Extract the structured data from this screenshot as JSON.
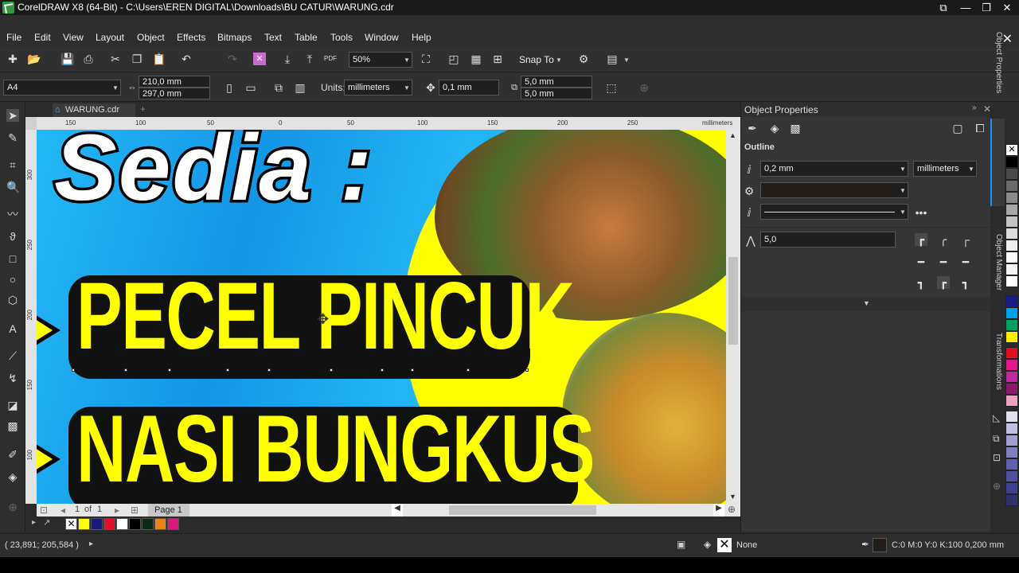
{
  "window": {
    "title": "CorelDRAW X8 (64-Bit) - C:\\Users\\EREN DIGITAL\\Downloads\\BU CATUR\\WARUNG.cdr"
  },
  "menu": [
    "File",
    "Edit",
    "View",
    "Layout",
    "Object",
    "Effects",
    "Bitmaps",
    "Text",
    "Table",
    "Tools",
    "Window",
    "Help"
  ],
  "toolbar": {
    "zoom": "50%",
    "snap": "Snap To"
  },
  "propbar": {
    "page_size": "A4",
    "width": "210,0 mm",
    "height": "297,0 mm",
    "units_label": "Units:",
    "units": "millimeters",
    "nudge": "0,1 mm",
    "dup_x": "5,0 mm",
    "dup_y": "5,0 mm"
  },
  "doc": {
    "tab": "WARUNG.cdr",
    "ruler_unit": "millimeters",
    "h_ticks": [
      "150",
      "100",
      "50",
      "0",
      "50",
      "100",
      "150",
      "200",
      "250"
    ],
    "v_ticks": [
      "300",
      "250",
      "200",
      "150",
      "100"
    ]
  },
  "artwork": {
    "line1": "Sedia :",
    "line2": "PECEL PINCUK",
    "line3": "NASI BUNGKUS"
  },
  "pages": {
    "current": "1",
    "of": "of",
    "total": "1",
    "page_tab": "Page 1"
  },
  "panel": {
    "title": "Object Properties",
    "section": "Outline",
    "width": "0,2 mm",
    "width_units": "millimeters",
    "miter": "5,0"
  },
  "vtabs": [
    "Object Properties",
    "Object Manager",
    "Transformations"
  ],
  "status": {
    "coords": "( 23,891; 205,584 )",
    "fill": "None",
    "outline": "C:0 M:0 Y:0 K:100  0,200 mm"
  },
  "colors": {
    "accent": "#1e90ff",
    "canvas": "#1dabf5",
    "yellow": "#ffff00"
  }
}
